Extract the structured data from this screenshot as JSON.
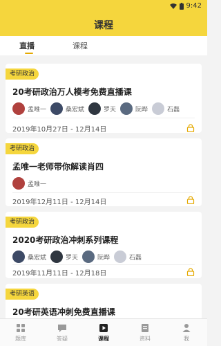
{
  "status": {
    "time": "9:42"
  },
  "header": {
    "title": "课程"
  },
  "tabs": [
    {
      "label": "直播"
    },
    {
      "label": "课程"
    }
  ],
  "cards": [
    {
      "badge": "考研政治",
      "title": "20考研政治万人模考免费直播课",
      "teachers": [
        "孟唯一",
        "桑宏斌",
        "罗天",
        "阮晔",
        "石磊"
      ],
      "date": "2019年10月27日 - 12月14日"
    },
    {
      "badge": "考研政治",
      "title": "孟唯一老师带你解读肖四",
      "teachers": [
        "孟唯一"
      ],
      "date": "2019年12月11日 - 12月14日"
    },
    {
      "badge": "考研政治",
      "title": "2020考研政治冲刺系列课程",
      "teachers": [
        "桑宏斌",
        "罗天",
        "阮晔",
        "石磊"
      ],
      "date": "2019年11月11日 - 12月18日"
    },
    {
      "badge": "考研英语",
      "title": "20考研英语冲刺免费直播课",
      "teachers": [],
      "date": ""
    }
  ],
  "bottom_nav": [
    {
      "label": "题库",
      "icon": "grid-icon"
    },
    {
      "label": "答疑",
      "icon": "chat-icon"
    },
    {
      "label": "课程",
      "icon": "play-icon"
    },
    {
      "label": "资料",
      "icon": "document-icon"
    },
    {
      "label": "我",
      "icon": "person-icon"
    }
  ]
}
